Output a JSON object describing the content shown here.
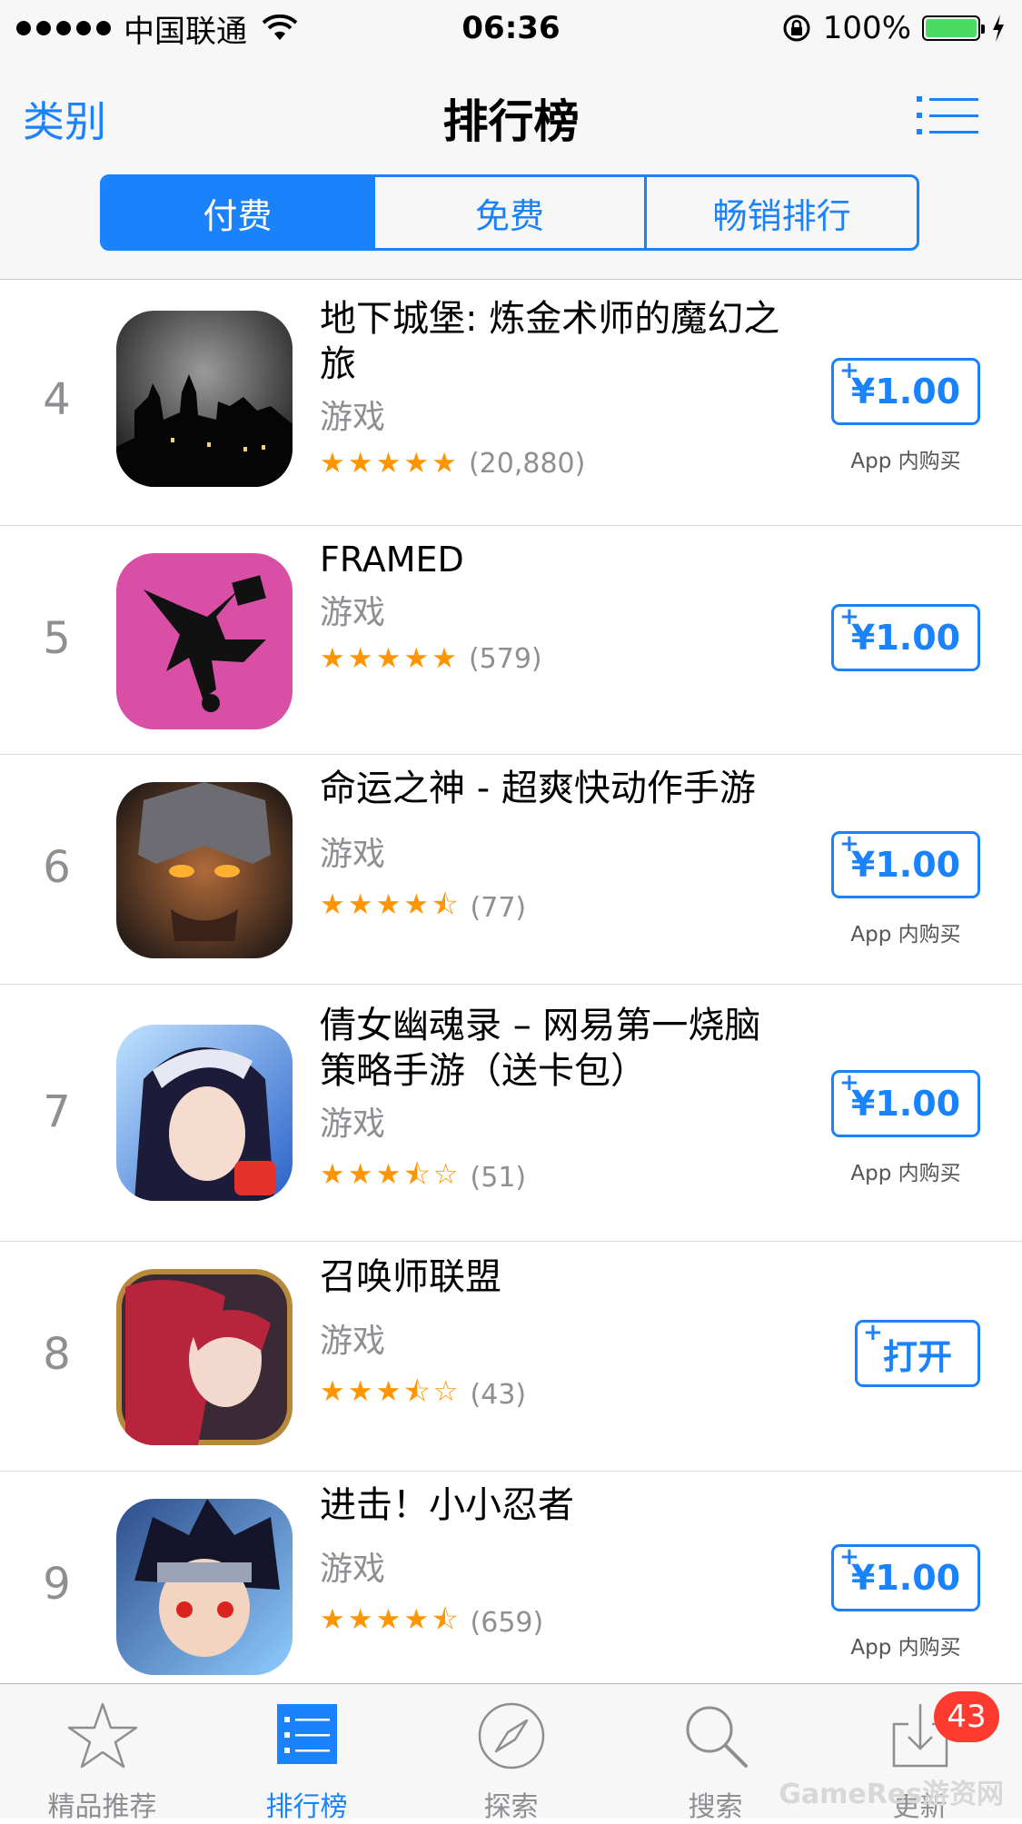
{
  "status_bar": {
    "carrier": "中国联通",
    "time": "06:36",
    "battery": "100%"
  },
  "nav": {
    "back": "类别",
    "title": "排行榜"
  },
  "segments": [
    "付费",
    "免费",
    "畅销排行"
  ],
  "apps": [
    {
      "rank": "4",
      "title": "地下城堡: 炼金术师的魔幻之旅",
      "category": "游戏",
      "stars": "★★★★★",
      "count": "(20,880)",
      "button": "¥1.00",
      "iap": "App 内购买"
    },
    {
      "rank": "5",
      "title": "FRAMED",
      "category": "游戏",
      "stars": "★★★★★",
      "count": "(579)",
      "button": "¥1.00",
      "iap": ""
    },
    {
      "rank": "6",
      "title": "命运之神 - 超爽快动作手游",
      "category": "游戏",
      "stars": "★★★★⯪",
      "count": "(77)",
      "button": "¥1.00",
      "iap": "App 内购买"
    },
    {
      "rank": "7",
      "title": "倩女幽魂录 – 网易第一烧脑策略手游（送卡包）",
      "category": "游戏",
      "stars": "★★★⯪☆",
      "count": "(51)",
      "button": "¥1.00",
      "iap": "App 内购买"
    },
    {
      "rank": "8",
      "title": "召唤师联盟",
      "category": "游戏",
      "stars": "★★★⯪☆",
      "count": "(43)",
      "button": "打开",
      "iap": ""
    },
    {
      "rank": "9",
      "title": "进击！小小忍者",
      "category": "游戏",
      "stars": "★★★★⯪",
      "count": "(659)",
      "button": "¥1.00",
      "iap": "App 内购买"
    }
  ],
  "tabs": [
    {
      "label": "精品推荐",
      "icon": "star-icon"
    },
    {
      "label": "排行榜",
      "icon": "list-icon"
    },
    {
      "label": "探索",
      "icon": "compass-icon"
    },
    {
      "label": "搜索",
      "icon": "search-icon"
    },
    {
      "label": "更新",
      "icon": "download-icon",
      "badge": "43"
    }
  ],
  "watermark": "GameRes游资网",
  "colors": {
    "accent": "#1a82fb",
    "star": "#ff9500",
    "badge": "#ff3b30"
  }
}
